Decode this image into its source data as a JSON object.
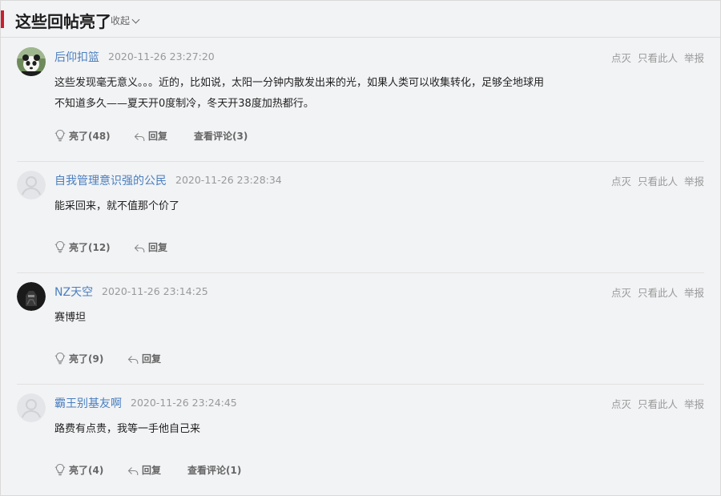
{
  "header": {
    "title": "这些回帖亮了",
    "collapse_label": "收起"
  },
  "ops": {
    "dim": "点灭",
    "only_this": "只看此人",
    "report": "举报"
  },
  "posts": [
    {
      "username": "后仰扣篮",
      "time": "2020-11-26 23:27:20",
      "content_lines": [
        "这些发现毫无意义。。。近的，比如说，太阳一分钟内散发出来的光，如果人类可以收集转化，足够全地球用",
        "不知道多久——夏天开0度制冷，冬天开38度加热都行。"
      ],
      "light_label": "亮了(48)",
      "reply_label": "回复",
      "comments_label": "查看评论(3)",
      "avatar": "panda-avatar"
    },
    {
      "username": "自我管理意识强的公民",
      "time": "2020-11-26 23:28:34",
      "content_lines": [
        "能采回来，就不值那个价了"
      ],
      "light_label": "亮了(12)",
      "reply_label": "回复",
      "avatar": "default-avatar"
    },
    {
      "username": "NZ天空",
      "time": "2020-11-26 23:14:25",
      "content_lines": [
        "赛博坦"
      ],
      "light_label": "亮了(9)",
      "reply_label": "回复",
      "avatar": "dark-avatar"
    },
    {
      "username": "霸王别基友啊",
      "time": "2020-11-26 23:24:45",
      "content_lines": [
        "路费有点贵，我等一手他自己来"
      ],
      "light_label": "亮了(4)",
      "reply_label": "回复",
      "comments_label": "查看评论(1)",
      "avatar": "default-avatar"
    }
  ],
  "colors": {
    "accent": "#c8202f",
    "username": "#4a7fbf",
    "muted": "#999999"
  }
}
